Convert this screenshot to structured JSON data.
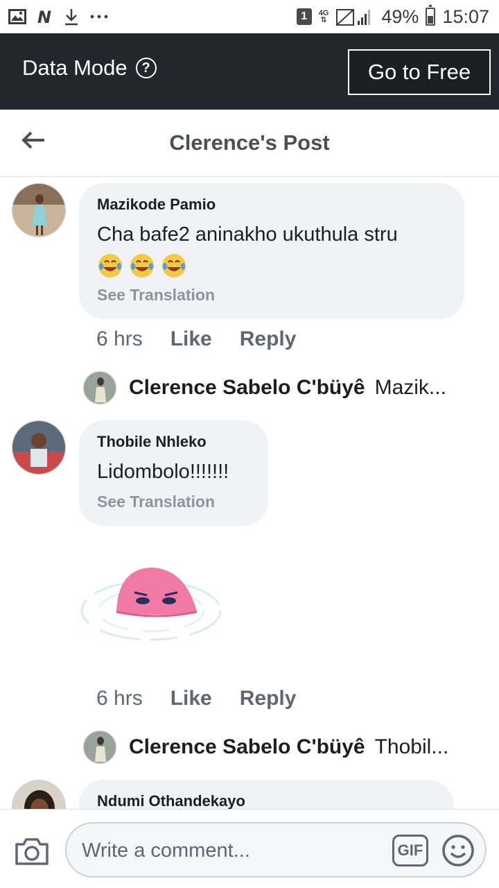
{
  "status_bar": {
    "sim": "1",
    "network": "4G",
    "battery": "49%",
    "battery_level": 0.49,
    "time": "15:07",
    "icons": [
      "gallery-icon",
      "netflix-icon",
      "download-icon",
      "more-dots-icon"
    ]
  },
  "data_mode": {
    "label": "Data Mode",
    "help": "?",
    "button": "Go to Free"
  },
  "header": {
    "title": "Clerence's Post"
  },
  "comments": [
    {
      "author": "Mazikode Pamio",
      "text": "Cha bafe2 aninakho ukuthula stru",
      "emojis": [
        "laughing-tears",
        "laughing-tears",
        "laughing-tears"
      ],
      "see_translation": "See Translation",
      "time": "6 hrs",
      "like": "Like",
      "reply": "Reply",
      "reply_preview": {
        "name": "Clerence Sabelo C'büyê",
        "text": "Mazik..."
      }
    },
    {
      "author": "Thobile Nhleko",
      "text": "Lidombolo!!!!!!!",
      "see_translation": "See Translation",
      "sticker": "pink-blob-sticker",
      "time": "6 hrs",
      "like": "Like",
      "reply": "Reply",
      "reply_preview": {
        "name": "Clerence Sabelo C'büyê",
        "text": "Thobil..."
      }
    },
    {
      "author": "Ndumi Othandekayo"
    }
  ],
  "composer": {
    "placeholder": "Write a comment...",
    "gif": "GIF"
  }
}
